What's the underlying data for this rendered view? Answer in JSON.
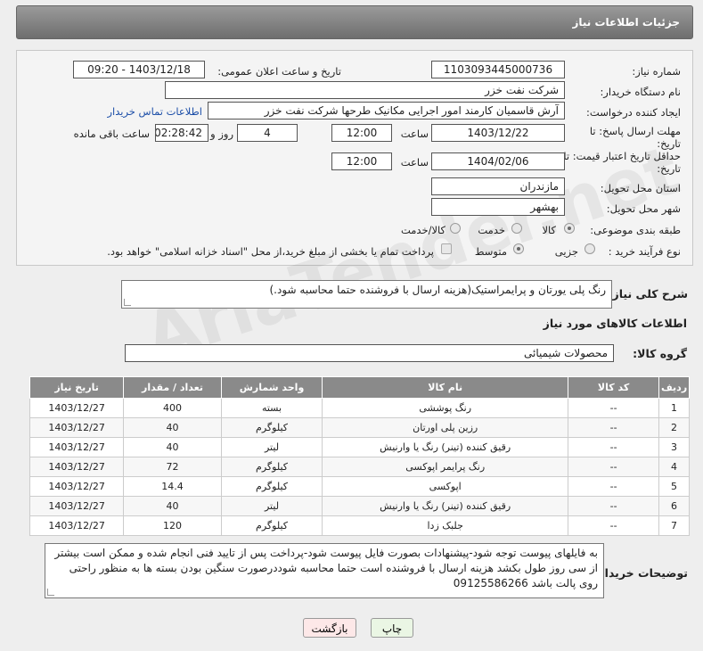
{
  "header": {
    "title": "جزئیات اطلاعات نیاز"
  },
  "form": {
    "need_number_label": "شماره نیاز:",
    "need_number": "1103093445000736",
    "announce_label": "تاریخ و ساعت اعلان عمومی:",
    "announce_value": "1403/12/18 - 09:20",
    "buyer_org_label": "نام دستگاه خریدار:",
    "buyer_org": "شرکت نفت خزر",
    "requester_label": "ایجاد کننده درخواست:",
    "requester": "آرش قاسمیان کارمند امور اجرایی مکانیک طرحها شرکت نفت خزر",
    "contact_link": "اطلاعات تماس خریدار",
    "reply_deadline_label": "مهلت ارسال پاسخ: تا",
    "reply_deadline_label2": "تاریخ:",
    "reply_date": "1403/12/22",
    "time_label": "ساعت",
    "reply_time": "12:00",
    "days_value": "4",
    "days_label": "روز و",
    "remaining_value": "02:28:42",
    "remaining_label": "ساعت باقی مانده",
    "price_validity_label": "حداقل تاریخ اعتبار قیمت: تا",
    "price_validity_label2": "تاریخ:",
    "price_date": "1404/02/06",
    "price_time": "12:00",
    "province_label": "استان محل تحویل:",
    "province": "مازندران",
    "city_label": "شهر محل تحویل:",
    "city": "بهشهر",
    "category_label": "طبقه بندی موضوعی:",
    "category_options": [
      "کالا",
      "خدمت",
      "کالا/خدمت"
    ],
    "process_label": "نوع فرآیند خرید :",
    "process_options": [
      "جزیی",
      "متوسط"
    ],
    "payment_note": "پرداخت تمام یا بخشی از مبلغ خرید،از محل \"اسناد خزانه اسلامی\" خواهد بود."
  },
  "summary": {
    "label": "شرح کلی نیاز:",
    "value": "رنگ پلی یورتان و پرایمراستیک(هزینه ارسال با فروشنده حتما محاسبه شود.)"
  },
  "goods_info": {
    "title": "اطلاعات کالاهای مورد نیاز",
    "group_label": "گروه کالا:",
    "group_value": "محصولات شیمیائی"
  },
  "table": {
    "headers": [
      "ردیف",
      "کد کالا",
      "نام کالا",
      "واحد شمارش",
      "تعداد / مقدار",
      "تاریخ نیاز"
    ],
    "rows": [
      [
        "1",
        "--",
        "رنگ پوششی",
        "بسته",
        "400",
        "1403/12/27"
      ],
      [
        "2",
        "--",
        "رزین پلی اورتان",
        "کیلوگرم",
        "40",
        "1403/12/27"
      ],
      [
        "3",
        "--",
        "رقیق کننده (تینر) رنگ یا وارنیش",
        "لیتر",
        "40",
        "1403/12/27"
      ],
      [
        "4",
        "--",
        "رنگ پرایمر اپوکسی",
        "کیلوگرم",
        "72",
        "1403/12/27"
      ],
      [
        "5",
        "--",
        "اپوکسی",
        "کیلوگرم",
        "14.4",
        "1403/12/27"
      ],
      [
        "6",
        "--",
        "رقیق کننده (تینر) رنگ یا وارنیش",
        "لیتر",
        "40",
        "1403/12/27"
      ],
      [
        "7",
        "--",
        "جلبک زدا",
        "کیلوگرم",
        "120",
        "1403/12/27"
      ]
    ]
  },
  "buyer_notes": {
    "label": "توضیحات خریدار:",
    "value": "به فایلهای پیوست توجه شود-پیشنهادات بصورت فایل پیوست شود-پرداخت پس از تایید فنی انجام شده و ممکن است بیشتر از سی روز طول بکشد هزینه ارسال با فروشنده است حتما محاسبه شوددرصورت سنگین بودن بسته ها به منظور راحتی روی پالت باشد 09125586266"
  },
  "buttons": {
    "print": "چاپ",
    "back": "بازگشت"
  },
  "watermark": "AriaTender.net",
  "colors": {
    "header": "#7d7d7d",
    "link": "#1d4fa8",
    "back_button": "#fde8e8",
    "print_button": "#eaf6e4"
  }
}
